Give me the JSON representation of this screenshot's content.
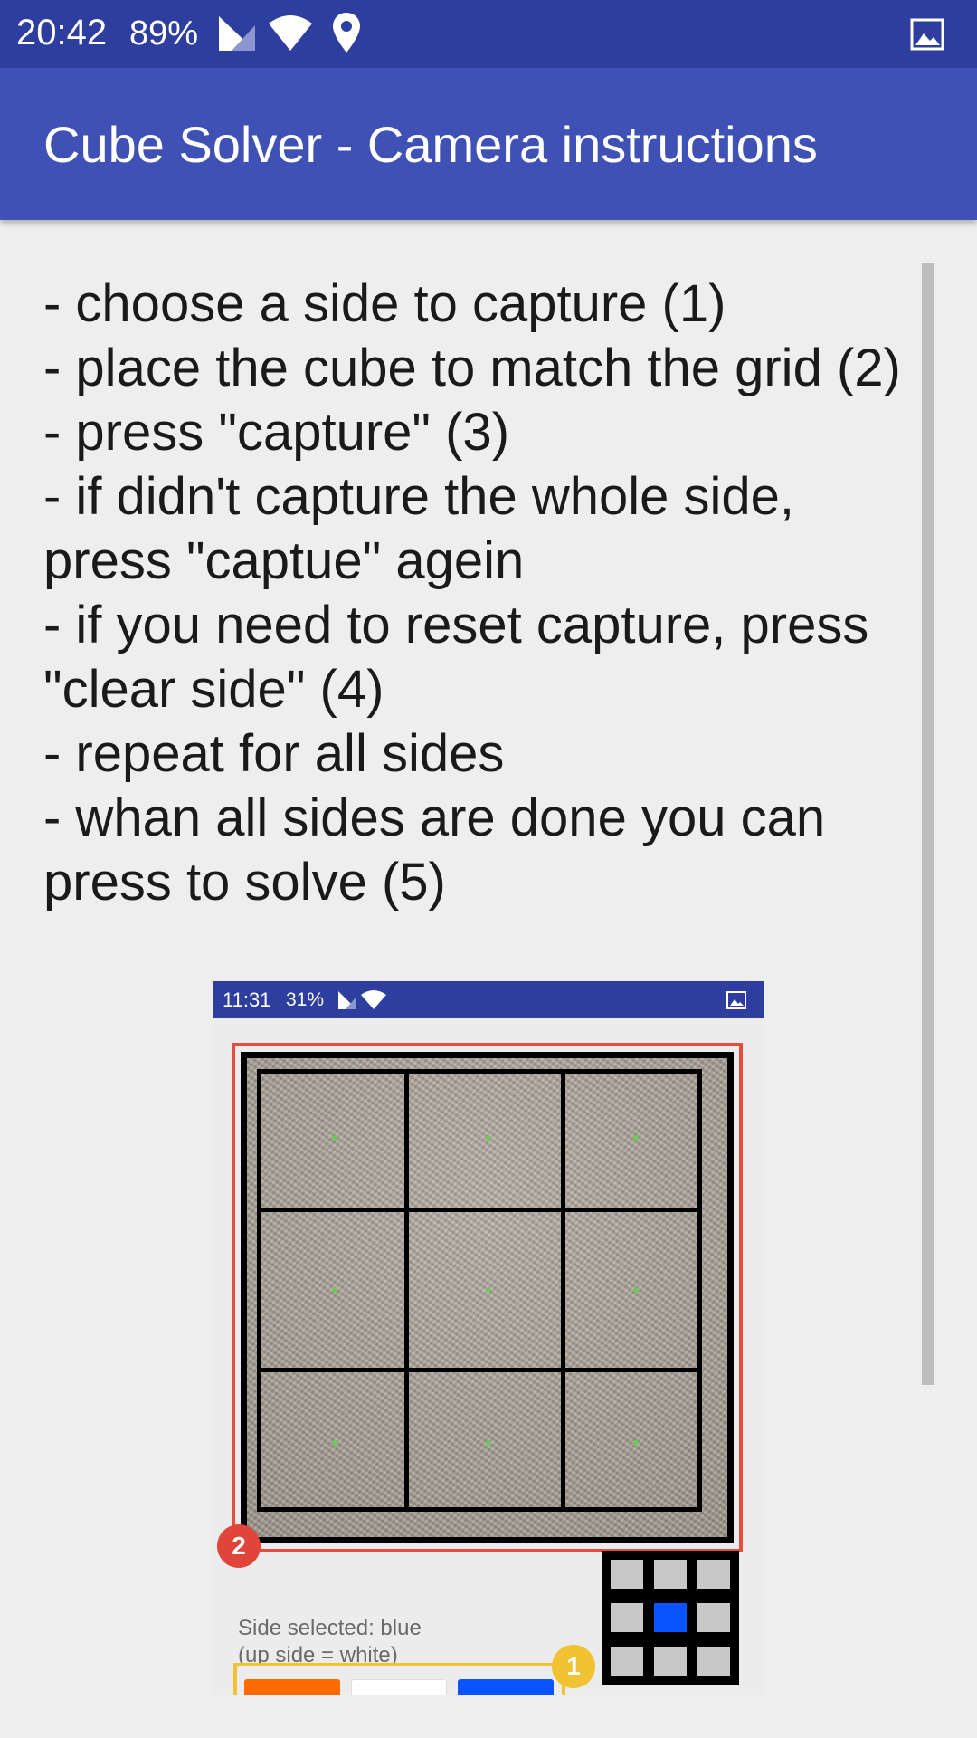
{
  "status_bar": {
    "time": "20:42",
    "battery": "89%",
    "icons": [
      "signal-icon",
      "wifi-icon",
      "location-icon",
      "image-icon"
    ]
  },
  "app_bar": {
    "title": "Cube Solver - Camera instructions"
  },
  "instructions": [
    "- choose a side to capture (1)",
    "- place the cube to match the grid (2)",
    "- press \"capture\" (3)",
    "- if didn't capture the whole side,",
    "press \"captue\" agein",
    "- if you need to reset capture, press",
    "\"clear side\" (4)",
    "- repeat for all sides",
    "- whan all sides are done you can",
    "press to solve (5)"
  ],
  "example_screenshot": {
    "status_time": "11:31",
    "status_battery": "31%",
    "badge_grid": "2",
    "badge_sides": "1",
    "side_selected": "Side selected: blue",
    "side_hint": "(up side = white)",
    "selected_side_color": "#0a54ff",
    "side_button_colors": [
      "#ff6a00",
      "#ffffff",
      "#0a54ff"
    ]
  },
  "colors": {
    "status_bar": "#2d3e9f",
    "app_bar": "#3f51b5",
    "background": "#eeeeee",
    "grid_highlight": "#e74c3c",
    "side_highlight": "#f1c232"
  }
}
